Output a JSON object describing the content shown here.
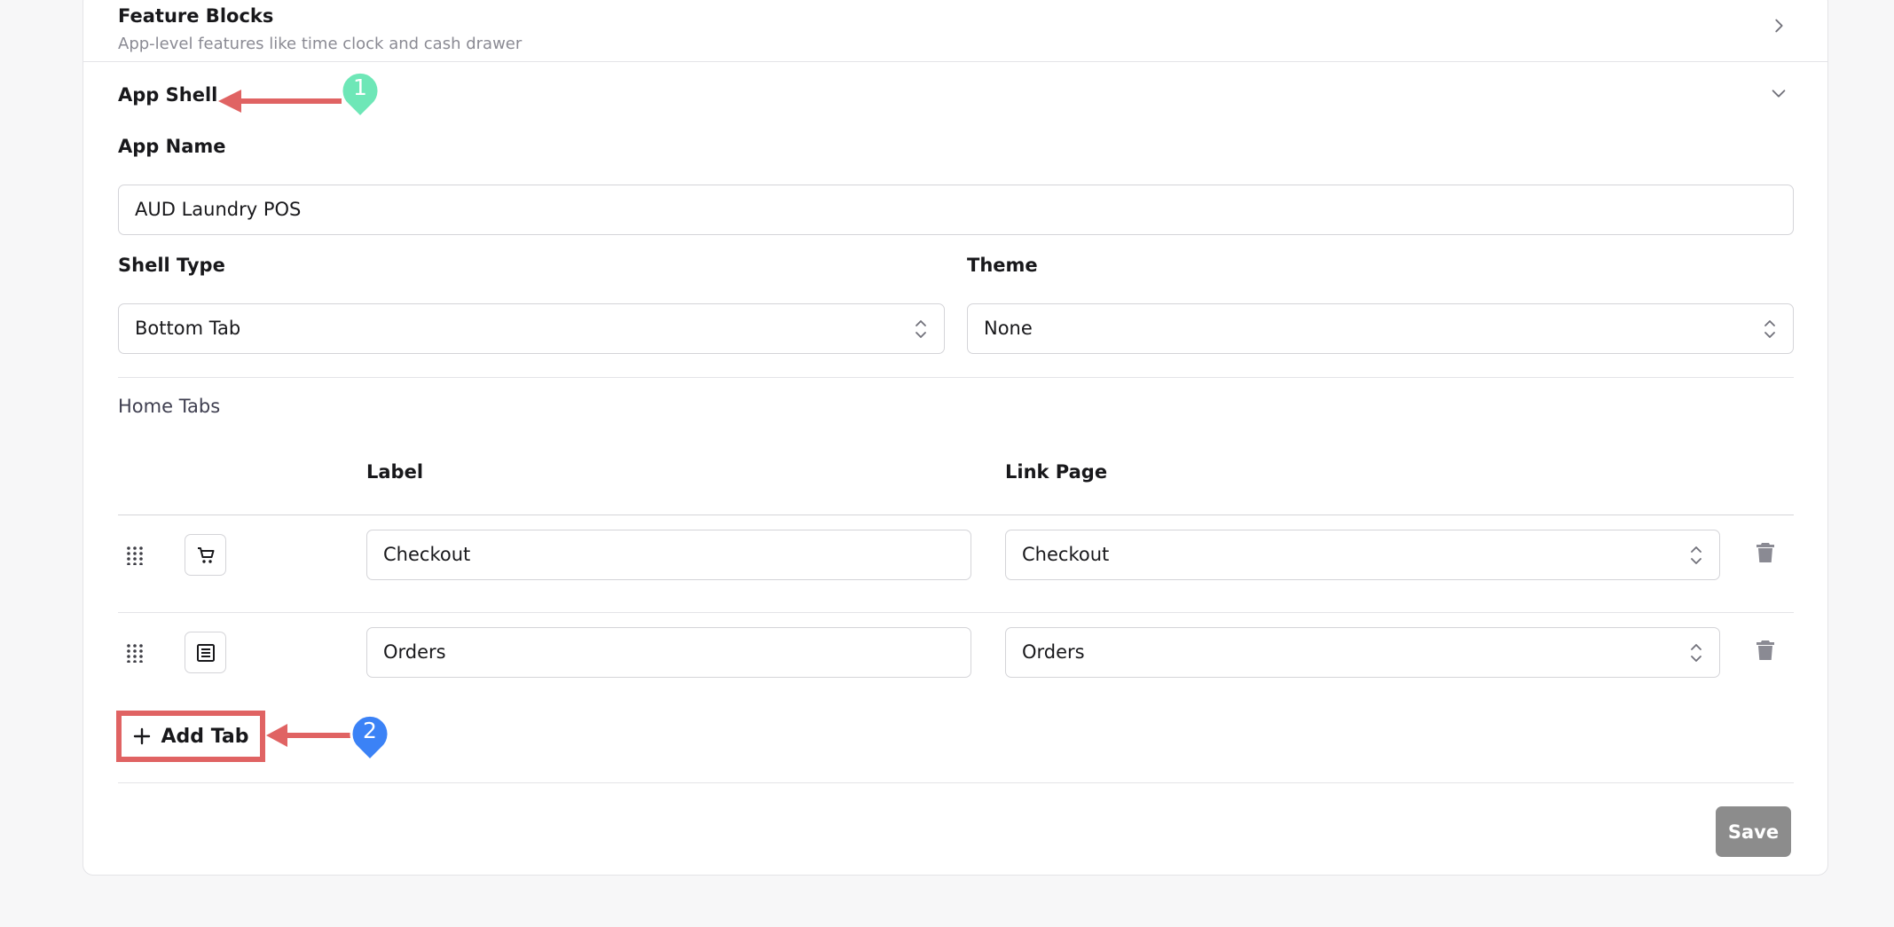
{
  "feature_blocks": {
    "title": "Feature Blocks",
    "subtitle": "App-level features like time clock and cash drawer"
  },
  "app_shell": {
    "title": "App Shell",
    "app_name_label": "App Name",
    "app_name_value": "AUD Laundry POS",
    "shell_type_label": "Shell Type",
    "shell_type_value": "Bottom Tab",
    "theme_label": "Theme",
    "theme_value": "None"
  },
  "home_tabs": {
    "section_label": "Home Tabs",
    "col_label": "Label",
    "col_link": "Link Page",
    "rows": [
      {
        "icon": "cart-icon",
        "label": "Checkout",
        "link": "Checkout"
      },
      {
        "icon": "list-icon",
        "label": "Orders",
        "link": "Orders"
      }
    ],
    "add_tab_label": "Add Tab"
  },
  "save_label": "Save",
  "annotations": {
    "marker_1": "1",
    "marker_2": "2",
    "marker_1_color": "#6ee7b7",
    "marker_2_color": "#3b82f6",
    "arrow_color": "#e06363"
  }
}
